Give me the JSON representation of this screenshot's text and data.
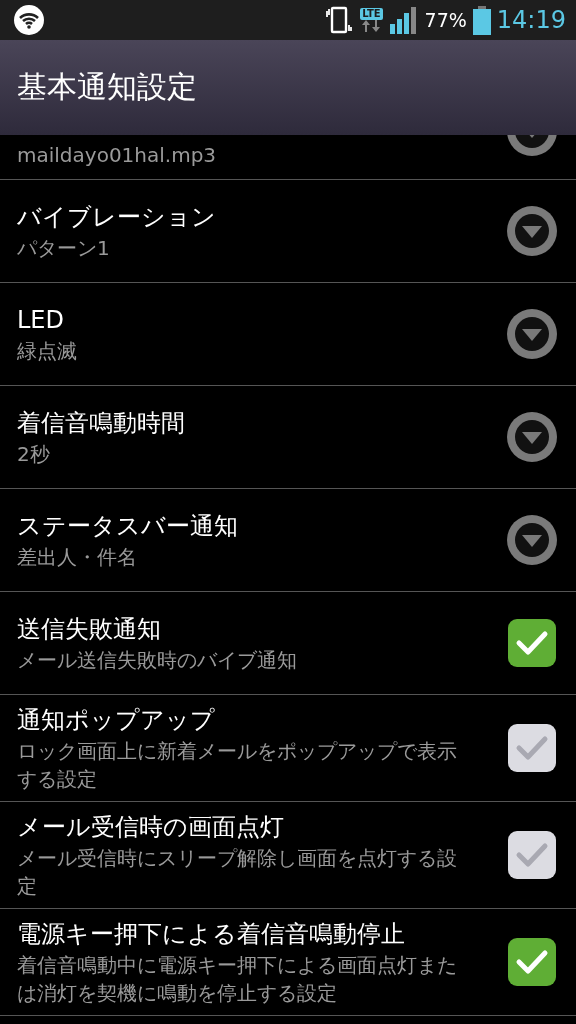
{
  "status_bar": {
    "network": "LTE",
    "battery": "77%",
    "time": "14:19"
  },
  "header": {
    "title": "基本通知設定"
  },
  "settings": [
    {
      "kind": "dropdown",
      "partial": true,
      "subtitle": "maildayo01hal.mp3"
    },
    {
      "kind": "dropdown",
      "title": "バイブレーション",
      "subtitle": "パターン1"
    },
    {
      "kind": "dropdown",
      "title": "LED",
      "subtitle": "緑点滅"
    },
    {
      "kind": "dropdown",
      "title": "着信音鳴動時間",
      "subtitle": "2秒"
    },
    {
      "kind": "dropdown",
      "title": "ステータスバー通知",
      "subtitle": "差出人・件名"
    },
    {
      "kind": "checkbox",
      "title": "送信失敗通知",
      "subtitle": "メール送信失敗時のバイブ通知",
      "checked": true
    },
    {
      "kind": "checkbox",
      "title": "通知ポップアップ",
      "subtitle": "ロック画面上に新着メールをポップアップで表示する設定",
      "checked": false
    },
    {
      "kind": "checkbox",
      "title": "メール受信時の画面点灯",
      "subtitle": "メール受信時にスリープ解除し画面を点灯する設定",
      "checked": false
    },
    {
      "kind": "checkbox",
      "title": "電源キー押下による着信音鳴動停止",
      "subtitle": "着信音鳴動中に電源キー押下による画面点灯または消灯を契機に鳴動を停止する設定",
      "checked": true
    }
  ]
}
